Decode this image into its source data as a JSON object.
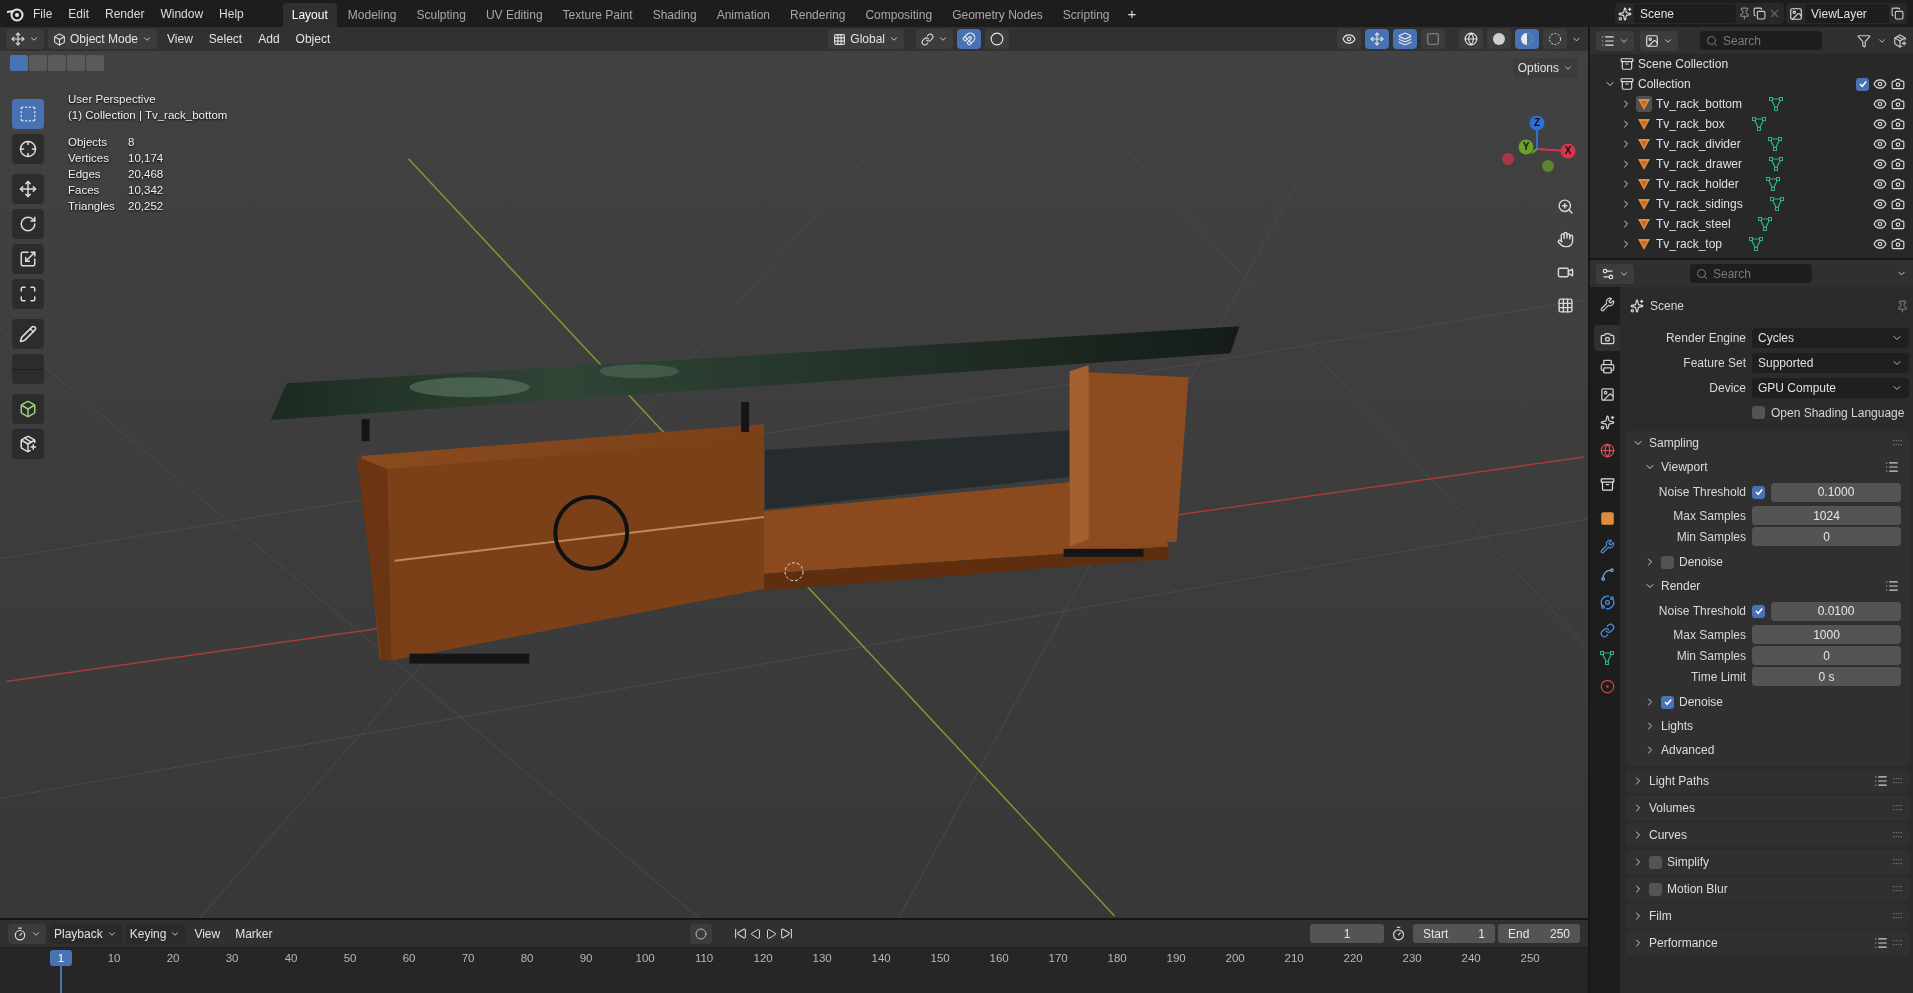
{
  "menu": [
    "File",
    "Edit",
    "Render",
    "Window",
    "Help"
  ],
  "workspaces": [
    {
      "label": "Layout",
      "selected": true
    },
    {
      "label": "Modeling",
      "selected": false
    },
    {
      "label": "Sculpting",
      "selected": false
    },
    {
      "label": "UV Editing",
      "selected": false
    },
    {
      "label": "Texture Paint",
      "selected": false
    },
    {
      "label": "Shading",
      "selected": false
    },
    {
      "label": "Animation",
      "selected": false
    },
    {
      "label": "Rendering",
      "selected": false
    },
    {
      "label": "Compositing",
      "selected": false
    },
    {
      "label": "Geometry Nodes",
      "selected": false
    },
    {
      "label": "Scripting",
      "selected": false
    }
  ],
  "add_workspace": "+",
  "scene": "Scene",
  "view_layer": "ViewLayer",
  "viewport": {
    "mode": "Object Mode",
    "menus": [
      "View",
      "Select",
      "Add",
      "Object"
    ],
    "orientation": "Global",
    "snap_toggles": [
      {
        "kind": "snap",
        "on": true
      },
      {
        "kind": "proportional",
        "on": false
      }
    ],
    "view_toggles": [
      {
        "kind": "visibility",
        "on": false
      },
      {
        "kind": "gizmo",
        "on": true
      },
      {
        "kind": "overlay",
        "on": true
      },
      {
        "kind": "xray",
        "on": false
      }
    ],
    "shading": [
      {
        "kind": "wireframe",
        "selected": false
      },
      {
        "kind": "solid",
        "selected": false
      },
      {
        "kind": "material",
        "selected": true
      },
      {
        "kind": "rendered",
        "selected": false
      }
    ],
    "select_modes": [
      {
        "selected": true
      },
      {
        "selected": false
      },
      {
        "selected": false
      },
      {
        "selected": false
      },
      {
        "selected": false
      }
    ],
    "options": "Options",
    "title": "User Perspective",
    "context": "(1) Collection | Tv_rack_bottom",
    "stats": [
      {
        "label": "Objects",
        "value": "8"
      },
      {
        "label": "Vertices",
        "value": "10,174"
      },
      {
        "label": "Edges",
        "value": "20,468"
      },
      {
        "label": "Faces",
        "value": "10,342"
      },
      {
        "label": "Triangles",
        "value": "20,252"
      }
    ],
    "axes": [
      {
        "label": "Z",
        "color": "#2f6fd6"
      },
      {
        "label": "Y",
        "color": "#6aa329"
      },
      {
        "label": "X",
        "color": "#d6354a"
      }
    ],
    "tools": [
      {
        "kind": "select",
        "selected": true
      },
      {
        "kind": "cursor",
        "selected": false
      },
      {
        "kind": "move",
        "selected": false
      },
      {
        "kind": "rotate",
        "selected": false
      },
      {
        "kind": "scale",
        "selected": false
      },
      {
        "kind": "transform",
        "selected": false
      },
      {
        "kind": "annotate",
        "selected": false
      },
      {
        "kind": "measure",
        "selected": false
      },
      {
        "kind": "add_cube",
        "selected": false
      },
      {
        "kind": "add_object",
        "selected": false
      }
    ]
  },
  "outliner": {
    "placeholder": "Search",
    "root": "Scene Collection",
    "collection": {
      "label": "Collection",
      "expanded": true,
      "checked": true,
      "children": [
        {
          "label": "Tv_rack_bottom",
          "selected": true
        },
        {
          "label": "Tv_rack_box",
          "selected": false
        },
        {
          "label": "Tv_rack_divider",
          "selected": false
        },
        {
          "label": "Tv_rack_drawer",
          "selected": false
        },
        {
          "label": "Tv_rack_holder",
          "selected": false
        },
        {
          "label": "Tv_rack_sidings",
          "selected": false
        },
        {
          "label": "Tv_rack_steel",
          "selected": false
        },
        {
          "label": "Tv_rack_top",
          "selected": false
        }
      ]
    }
  },
  "properties": {
    "placeholder": "Search",
    "context": "Scene",
    "tabs": [
      {
        "kind": "tool",
        "selected": false
      },
      {
        "kind": "render",
        "selected": true
      },
      {
        "kind": "output",
        "selected": false
      },
      {
        "kind": "view_layer",
        "selected": false
      },
      {
        "kind": "scene",
        "selected": false
      },
      {
        "kind": "world",
        "selected": false
      },
      {
        "kind": "collection",
        "selected": false
      },
      {
        "kind": "object",
        "selected": false
      },
      {
        "kind": "modifier",
        "selected": false
      },
      {
        "kind": "particles",
        "selected": false
      },
      {
        "kind": "physics",
        "selected": false
      },
      {
        "kind": "constraints",
        "selected": false
      },
      {
        "kind": "data",
        "selected": false
      },
      {
        "kind": "material",
        "selected": false
      }
    ],
    "fields": [
      {
        "kind": "dropdown",
        "label": "Render Engine",
        "value": "Cycles"
      },
      {
        "kind": "dropdown",
        "label": "Feature Set",
        "value": "Supported"
      },
      {
        "kind": "dropdown",
        "label": "Device",
        "value": "GPU Compute"
      },
      {
        "kind": "checkbox",
        "label": "Open Shading Language",
        "checked": false
      }
    ],
    "panels": [
      {
        "label": "Sampling",
        "expanded": true,
        "presets": false,
        "children": [
          {
            "label": "Viewport",
            "expanded": true,
            "presets": true,
            "rows": [
              {
                "kind": "toggle_number",
                "label": "Noise Threshold",
                "checked": true,
                "value": "0.1000"
              },
              {
                "kind": "number",
                "label": "Max Samples",
                "value": "1024"
              },
              {
                "kind": "number",
                "label": "Min Samples",
                "value": "0"
              }
            ]
          },
          {
            "label": "Denoise",
            "expanded": false,
            "presets": false,
            "checked": false
          },
          {
            "label": "Render",
            "expanded": true,
            "presets": true,
            "rows": [
              {
                "kind": "toggle_number",
                "label": "Noise Threshold",
                "checked": true,
                "value": "0.0100"
              },
              {
                "kind": "number",
                "label": "Max Samples",
                "value": "1000"
              },
              {
                "kind": "number",
                "label": "Min Samples",
                "value": "0"
              },
              {
                "kind": "number",
                "label": "Time Limit",
                "value": "0 s"
              }
            ]
          },
          {
            "label": "Denoise",
            "expanded": false,
            "presets": false,
            "checked": true
          },
          {
            "label": "Lights",
            "expanded": false,
            "presets": false
          },
          {
            "label": "Advanced",
            "expanded": false,
            "presets": false
          }
        ]
      },
      {
        "label": "Light Paths",
        "expanded": false,
        "presets": true
      },
      {
        "label": "Volumes",
        "expanded": false,
        "presets": false
      },
      {
        "label": "Curves",
        "expanded": false,
        "presets": false
      },
      {
        "label": "Simplify",
        "expanded": false,
        "presets": false,
        "checked": false
      },
      {
        "label": "Motion Blur",
        "expanded": false,
        "presets": false,
        "checked": false
      },
      {
        "label": "Film",
        "expanded": false,
        "presets": false
      },
      {
        "label": "Performance",
        "expanded": false,
        "presets": true
      }
    ]
  },
  "timeline": {
    "menus": [
      {
        "label": "Playback",
        "kind": "dropdown"
      },
      {
        "label": "Keying",
        "kind": "dropdown"
      },
      {
        "label": "View",
        "kind": "menu"
      },
      {
        "label": "Marker",
        "kind": "menu"
      }
    ],
    "current_frame": "1",
    "start_label": "Start",
    "start": "1",
    "end_label": "End",
    "end": "250",
    "playhead": "1",
    "ticks": [
      "10",
      "20",
      "30",
      "40",
      "50",
      "60",
      "70",
      "80",
      "90",
      "100",
      "110",
      "120",
      "130",
      "140",
      "150",
      "160",
      "170",
      "180",
      "190",
      "200",
      "210",
      "220",
      "230",
      "240",
      "250"
    ]
  }
}
